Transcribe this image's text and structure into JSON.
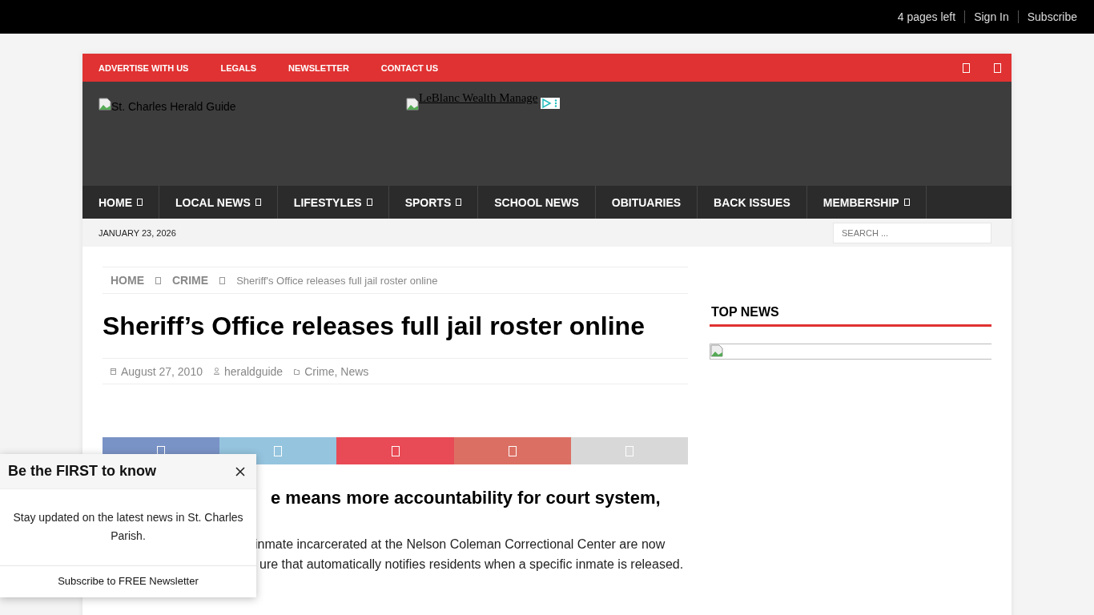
{
  "top_bar": {
    "pages_left": "4 pages left",
    "links": [
      "Sign In",
      "Subscribe"
    ]
  },
  "red_bar": {
    "links": [
      "ADVERTISE WITH US",
      "LEGALS",
      "NEWSLETTER",
      "CONTACT US"
    ]
  },
  "header": {
    "logo_alt": "St. Charles Herald Guide",
    "ad_alt": "LeBlanc Wealth Manage"
  },
  "nav": [
    {
      "label": "HOME",
      "has_dropdown": true
    },
    {
      "label": "LOCAL NEWS",
      "has_dropdown": true
    },
    {
      "label": "LIFESTYLES",
      "has_dropdown": true
    },
    {
      "label": "SPORTS",
      "has_dropdown": true
    },
    {
      "label": "SCHOOL NEWS",
      "has_dropdown": false
    },
    {
      "label": "OBITUARIES",
      "has_dropdown": false
    },
    {
      "label": "BACK ISSUES",
      "has_dropdown": false
    },
    {
      "label": "MEMBERSHIP",
      "has_dropdown": true
    }
  ],
  "date": "JANUARY 23, 2026",
  "search": {
    "placeholder": "SEARCH ..."
  },
  "breadcrumb": [
    {
      "label": "HOME",
      "kind": "link"
    },
    {
      "label": "CRIME",
      "kind": "link"
    },
    {
      "label": "Sheriff's Office releases full jail roster online",
      "kind": "current"
    }
  ],
  "article": {
    "title": "Sheriff’s Office releases full jail roster online",
    "meta": [
      {
        "kind": "date",
        "text": "August 27, 2010"
      },
      {
        "kind": "author",
        "text": "heraldguide"
      },
      {
        "kind": "category",
        "text": "Crime, News"
      }
    ],
    "share": [
      {
        "color": "#7a93c6"
      },
      {
        "color": "#95c4de"
      },
      {
        "color": "#e84b55"
      },
      {
        "color": "#dc6f63"
      },
      {
        "color": "#d8d8d8"
      }
    ],
    "subheading": "e means more accountability for court system,",
    "paragraph_lines": [
      "inmate incarcerated at the Nelson Coleman Correctional Center are now",
      "ure that automatically notifies residents when a specific inmate is released."
    ]
  },
  "sidebar": {
    "heading": "TOP NEWS"
  },
  "popup": {
    "title": "Be the FIRST to know",
    "body": "Stay updated on the latest news in St. Charles Parish.",
    "link": "Subscribe to FREE Newsletter"
  }
}
